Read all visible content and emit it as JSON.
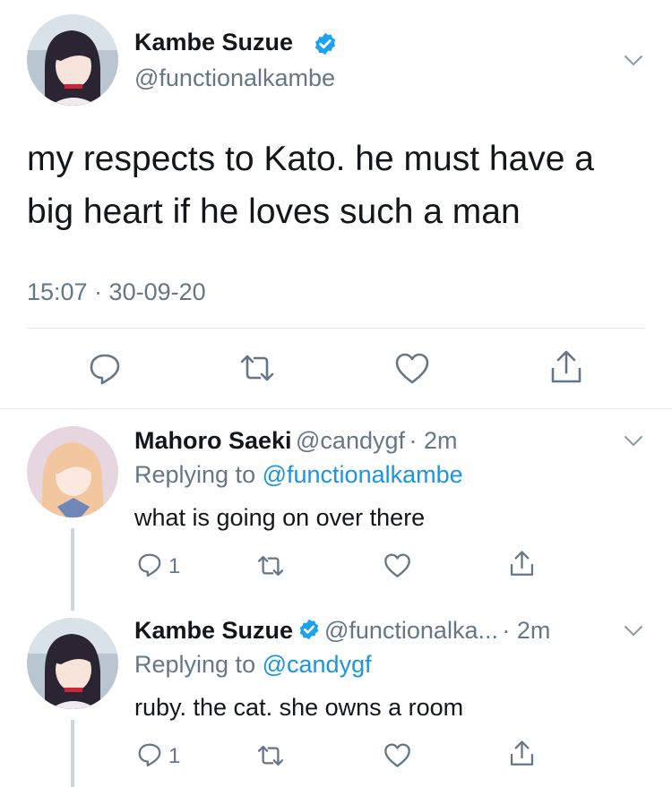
{
  "main_tweet": {
    "author_name": "Kambe Suzue",
    "author_handle": "@functionalkambe",
    "verified": true,
    "text_line1": "my respects to Kato. he must have a",
    "text_line2": "big heart if he loves such a man",
    "timestamp": "15:07 · 30-09-20",
    "actions": [
      "reply-icon",
      "retweet-icon",
      "like-icon",
      "share-icon"
    ]
  },
  "replies": [
    {
      "author_name": "Mahoro Saeki",
      "author_handle": "@candygf",
      "time": "· 2m",
      "replying_prefix": "Replying to",
      "replying_to": "@functionalkambe",
      "text": "what is going on over there",
      "reply_count": "1"
    },
    {
      "author_name": "Kambe Suzue",
      "author_handle": "@functionalka...",
      "time": "· 2m",
      "verified": true,
      "replying_prefix": "Replying to",
      "replying_to": "@candygf",
      "text": "ruby. the cat. she owns a room",
      "reply_count": "1"
    }
  ],
  "colors": {
    "text": "#14171a",
    "secondary": "#657786",
    "link": "#1b95e0",
    "verified": "#1da1f2",
    "divider": "#e1e8ed"
  }
}
